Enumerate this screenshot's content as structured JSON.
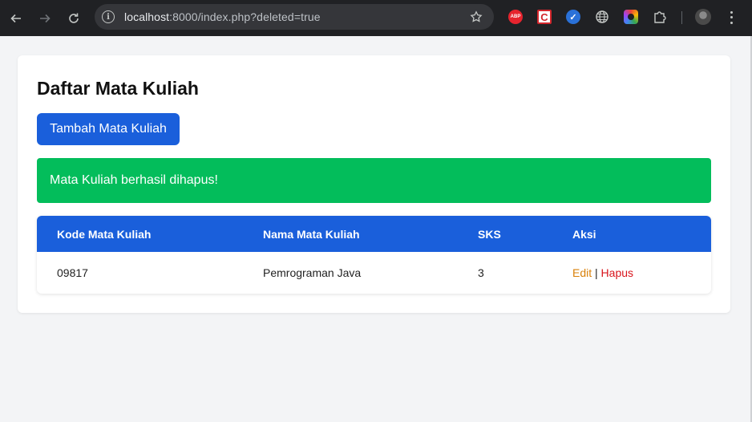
{
  "browser": {
    "url_host": "localhost",
    "url_path": ":8000/index.php?deleted=true",
    "extensions": [
      "abp-icon",
      "c-extension-icon",
      "v-extension-icon",
      "globe-icon",
      "color-ring-icon",
      "puzzle-icon"
    ],
    "abp_label": "ABP",
    "c_label": "C",
    "v_label": "✓"
  },
  "page": {
    "title": "Daftar Mata Kuliah",
    "add_button": "Tambah Mata Kuliah",
    "alert": "Mata Kuliah berhasil dihapus!",
    "table": {
      "headers": [
        "Kode Mata Kuliah",
        "Nama Mata Kuliah",
        "SKS",
        "Aksi"
      ],
      "rows": [
        {
          "kode": "09817",
          "nama": "Pemrograman Java",
          "sks": "3",
          "edit": "Edit",
          "separator": "|",
          "hapus": "Hapus"
        }
      ]
    }
  },
  "colors": {
    "primary": "#1a5fdb",
    "success": "#03bd5b",
    "edit": "#d98009",
    "delete": "#d8141c"
  }
}
